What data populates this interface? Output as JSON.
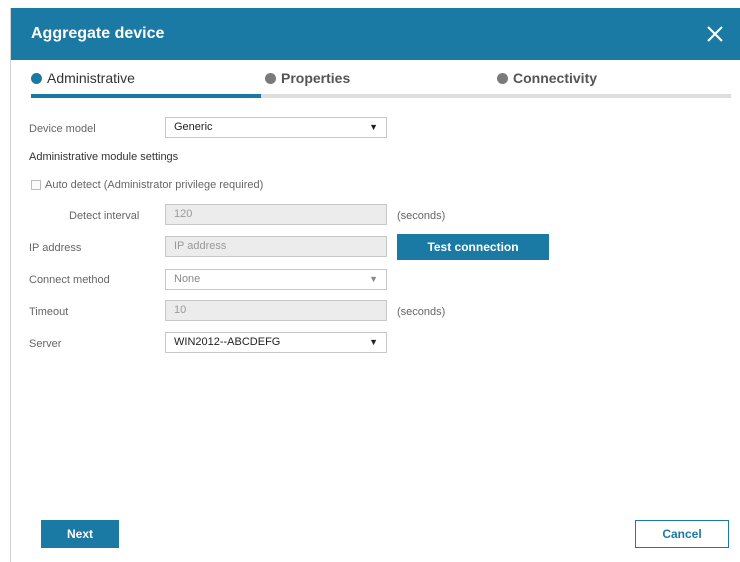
{
  "dialog": {
    "title": "Aggregate device",
    "close_icon": "close-icon"
  },
  "steps": [
    {
      "label": "Administrative",
      "state": "active"
    },
    {
      "label": "Properties",
      "state": "inactive"
    },
    {
      "label": "Connectivity",
      "state": "inactive"
    }
  ],
  "form": {
    "device_model": {
      "label": "Device model",
      "value": "Generic"
    },
    "section_title": "Administrative module settings",
    "auto_detect": {
      "label": "Auto detect (Administrator privilege required)",
      "checked": false
    },
    "detect_interval": {
      "label": "Detect interval",
      "value": "120",
      "unit": "(seconds)"
    },
    "ip_address": {
      "label": "IP address",
      "placeholder": "IP address"
    },
    "test_connection_label": "Test connection",
    "connect_method": {
      "label": "Connect method",
      "value": "None"
    },
    "timeout": {
      "label": "Timeout",
      "value": "10",
      "unit": "(seconds)"
    },
    "server": {
      "label": "Server",
      "value": "WIN2012--ABCDEFG"
    }
  },
  "footer": {
    "next_label": "Next",
    "cancel_label": "Cancel"
  },
  "colors": {
    "accent": "#1b7aa4",
    "disabled_field": "#ececec"
  }
}
